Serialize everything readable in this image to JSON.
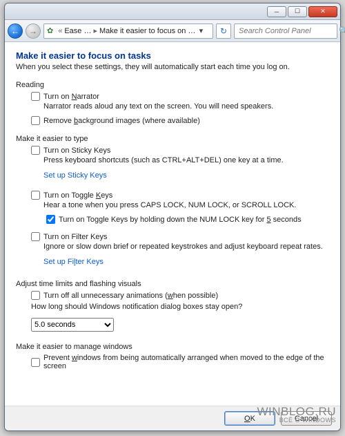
{
  "breadcrumb": {
    "seg1": "Ease …",
    "seg2": "Make it easier to focus on …"
  },
  "search": {
    "placeholder": "Search Control Panel"
  },
  "page": {
    "title": "Make it easier to focus on tasks",
    "subtitle": "When you select these settings, they will automatically start each time you log on."
  },
  "reading": {
    "head": "Reading",
    "narrator": "Turn on Narrator",
    "narrator_u": "N",
    "narrator_explain": "Narrator reads aloud any text on the screen. You will need speakers.",
    "removebg_pre": "Remove ",
    "removebg_u": "b",
    "removebg_post": "ackground images (where available)"
  },
  "typing": {
    "head": "Make it easier to type",
    "sticky": "Turn on Sticky Keys",
    "sticky_explain": "Press keyboard shortcuts (such as CTRL+ALT+DEL) one key at a time.",
    "sticky_link": "Set up Sticky Keys",
    "toggle_pre": "Turn on Toggle ",
    "toggle_u": "K",
    "toggle_post": "eys",
    "toggle_explain": "Hear a tone when you press CAPS LOCK, NUM LOCK, or SCROLL LOCK.",
    "toggle_nested_pre": "Turn on Toggle Keys by holding down the NUM LOCK key for ",
    "toggle_nested_u": "5",
    "toggle_nested_post": " seconds",
    "filter": "Turn on Filter Keys",
    "filter_explain": "Ignore or slow down brief or repeated keystrokes and adjust keyboard repeat rates.",
    "filter_link_pre": "Set up Fi",
    "filter_link_u": "l",
    "filter_link_post": "ter Keys"
  },
  "visuals": {
    "head": "Adjust time limits and flashing visuals",
    "animoff_pre": "Turn off all unnecessary animations (",
    "animoff_u": "w",
    "animoff_post": "hen possible)",
    "duration_label": "How long should Windows notification dialog boxes stay open?",
    "duration_value": "5.0 seconds"
  },
  "windows": {
    "head": "Make it easier to manage windows",
    "prevent_pre": "Prevent ",
    "prevent_u": "w",
    "prevent_post": "indows from being automatically arranged when moved to the edge of the screen"
  },
  "buttons": {
    "ok": "OK",
    "ok_u": "O",
    "cancel": "Cancel"
  },
  "watermark": {
    "line1": "WINBLOG.RU",
    "line2": "ВСЁ О WINDOWS"
  }
}
